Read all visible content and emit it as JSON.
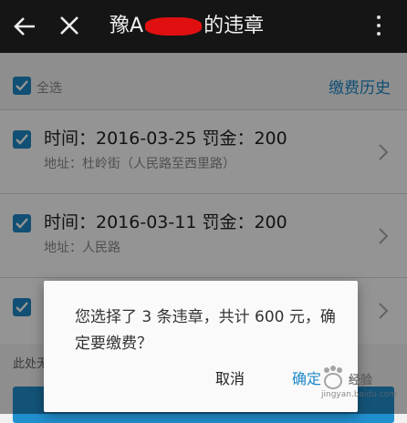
{
  "header": {
    "title_prefix": "豫A",
    "title_suffix": "的违章"
  },
  "toolbar": {
    "select_all_label": "全选",
    "history_label": "缴费历史"
  },
  "violations": [
    {
      "time_label": "时间：2016-03-25 罚金：200",
      "address_label": "地址：杜岭街（人民路至西里路）"
    },
    {
      "time_label": "时间：2016-03-11 罚金：200",
      "address_label": "地址：人民路"
    }
  ],
  "footer": {
    "note": "此处无"
  },
  "dialog": {
    "message": "您选择了 3 条违章，共计 600 元，确定要缴费？",
    "cancel_label": "取消",
    "confirm_label": "确定"
  },
  "watermark": {
    "text": "经验",
    "sub": "jingyan.baidu.com"
  }
}
